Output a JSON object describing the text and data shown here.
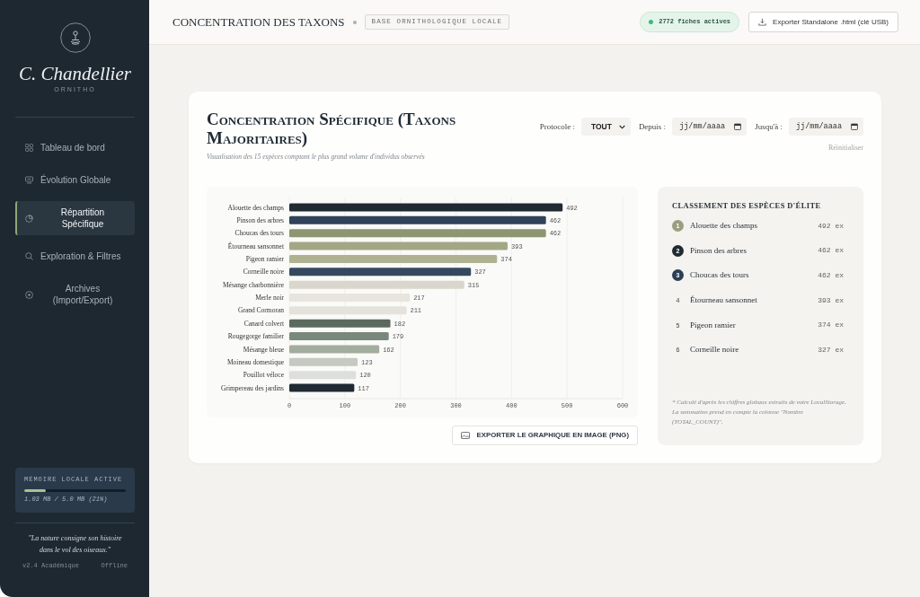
{
  "sidebar": {
    "brand": {
      "name": "C. Chandellier",
      "tagline": "ORNITHO"
    },
    "nav": [
      {
        "label": "Tableau de bord",
        "selected": false
      },
      {
        "label": "Évolution Globale",
        "selected": false
      },
      {
        "label": "Répartition Spécifique",
        "selected": true
      },
      {
        "label": "Exploration & Filtres",
        "selected": false
      },
      {
        "label": "Archives (Import/Export)",
        "selected": false
      }
    ],
    "storage": {
      "title": "MÉMOIRE LOCALE ACTIVE",
      "level": 0.21,
      "reading": "1.03 MB / 5.0 MB (21%)"
    },
    "quote": "\"La nature consigne son histoire dans le vol des oiseaux.\"",
    "version": "v2.4 Académique",
    "status": "Offline"
  },
  "header": {
    "title": "CONCENTRATION DES TAXONS",
    "tag": "BASE ORNITHOLOGIQUE LOCALE",
    "records": "2772 fiches actives",
    "export_button": "Exporter Standalone .html (clé USB)"
  },
  "card": {
    "title": "Concentration Spécifique (Taxons Majoritaires)",
    "subtitle": "Visualisation des 15 espèces comptant le plus grand volume d'individus observés",
    "filters": {
      "protocol": {
        "label": "Protocole :",
        "value": "TOUT"
      },
      "from": {
        "label": "Depuis :",
        "placeholder": "jj/mm/aaaa"
      },
      "to": {
        "label": "Jusqu'à :",
        "placeholder": "jj/mm/aaaa"
      },
      "reset": "Réinitialiser"
    },
    "chart": {
      "chart_data": {
        "type": "bar",
        "orientation": "horizontal",
        "categories": [
          "Alouette des champs",
          "Pinson des arbres",
          "Choucas des tours",
          "Étourneau sansonnet",
          "Pigeon ramier",
          "Corneille noire",
          "Mésange charbonnière",
          "Merle noir",
          "Grand Cormoran",
          "Canard colvert",
          "Rougegorge familier",
          "Mésange bleue",
          "Moineau domestique",
          "Pouillot véloce",
          "Grimpereau des jardins"
        ],
        "values": [
          492,
          462,
          462,
          393,
          374,
          327,
          315,
          217,
          211,
          182,
          179,
          162,
          123,
          120,
          117
        ],
        "colors": [
          "#1f2a33",
          "#2f4259",
          "#8e9572",
          "#a3a785",
          "#aeb290",
          "#34495f",
          "#d9d6cb",
          "#e7e5dd",
          "#e4e2da",
          "#5c695e",
          "#78887a",
          "#a2ad9e",
          "#c5c9c1",
          "#dddfdb",
          "#1f2a33"
        ],
        "xlim": [
          0,
          600
        ],
        "xticks": [
          0,
          100,
          200,
          300,
          400,
          500,
          600
        ],
        "grid": true,
        "data_labels": true
      }
    },
    "export_button": "EXPORTER LE GRAPHIQUE EN IMAGE (PNG)",
    "ranking": {
      "title": "CLASSEMENT DES ESPÈCES D'ÉLITE",
      "items": [
        {
          "rank": "1",
          "name": "Alouette des champs",
          "count": "492 ex",
          "color": "#9a9f7f"
        },
        {
          "rank": "2",
          "name": "Pinson des arbres",
          "count": "462 ex",
          "color": "#1f2a33"
        },
        {
          "rank": "3",
          "name": "Choucas des tours",
          "count": "462 ex",
          "color": "#2c3e55"
        },
        {
          "rank": "4",
          "name": "Étourneau sansonnet",
          "count": "393 ex"
        },
        {
          "rank": "5",
          "name": "Pigeon ramier",
          "count": "374 ex"
        },
        {
          "rank": "6",
          "name": "Corneille noire",
          "count": "327 ex"
        }
      ],
      "note": "* Calculé d'après les chiffres globaux extraits de votre LocalStorage. La sommation prend en compte la colonne \"Nombre (TOTAL_COUNT)\"."
    }
  }
}
